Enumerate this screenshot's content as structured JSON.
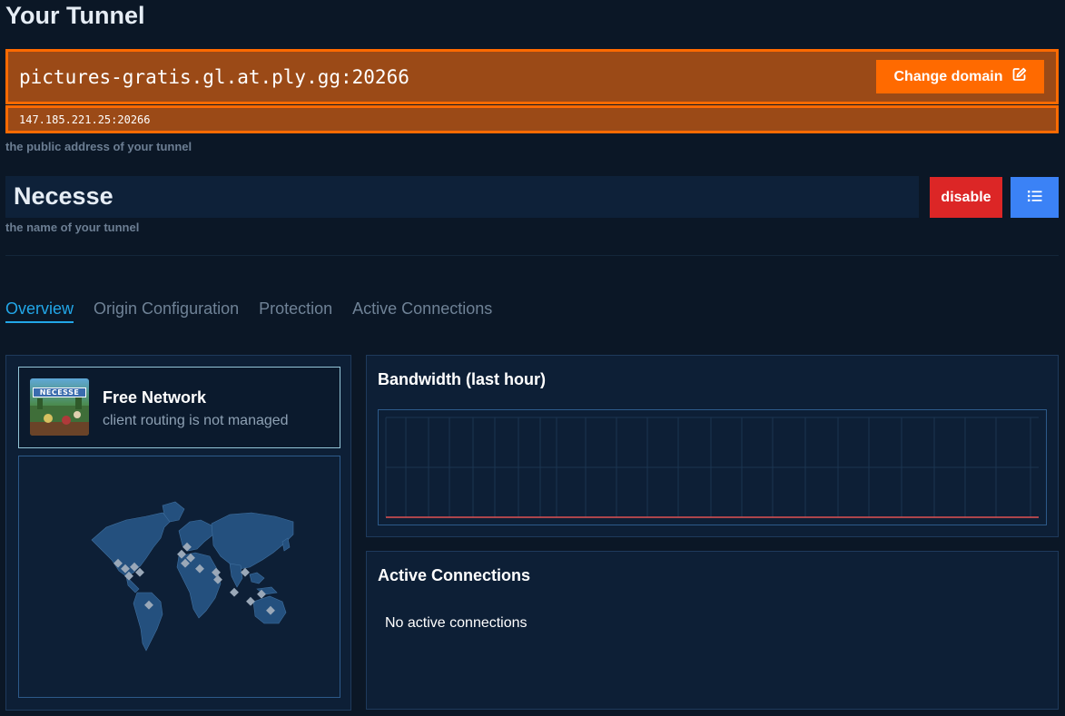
{
  "page": {
    "title": "Your Tunnel"
  },
  "tunnel": {
    "domain": "pictures-gratis.gl.at.ply.gg:20266",
    "ip": "147.185.221.25:20266",
    "address_hint": "the public address of your tunnel",
    "change_domain_label": "Change domain",
    "name": "Necesse",
    "name_hint": "the name of your tunnel",
    "disable_label": "disable"
  },
  "tabs": [
    {
      "label": "Overview",
      "active": true
    },
    {
      "label": "Origin Configuration",
      "active": false
    },
    {
      "label": "Protection",
      "active": false
    },
    {
      "label": "Active Connections",
      "active": false
    }
  ],
  "network": {
    "game_thumb_label": "NECESSE",
    "title": "Free Network",
    "subtitle": "client routing is not managed"
  },
  "bandwidth": {
    "title": "Bandwidth (last hour)"
  },
  "connections": {
    "title": "Active Connections",
    "empty_message": "No active connections"
  },
  "colors": {
    "accent_orange": "#ff6a00",
    "domain_bg": "#9b4a17",
    "danger": "#dc2626",
    "primary": "#3b82f6",
    "tab_active": "#22a7e8",
    "chart_line": "#e05252"
  },
  "icons": {
    "change_domain": "edit-icon",
    "list_button": "list-icon"
  }
}
